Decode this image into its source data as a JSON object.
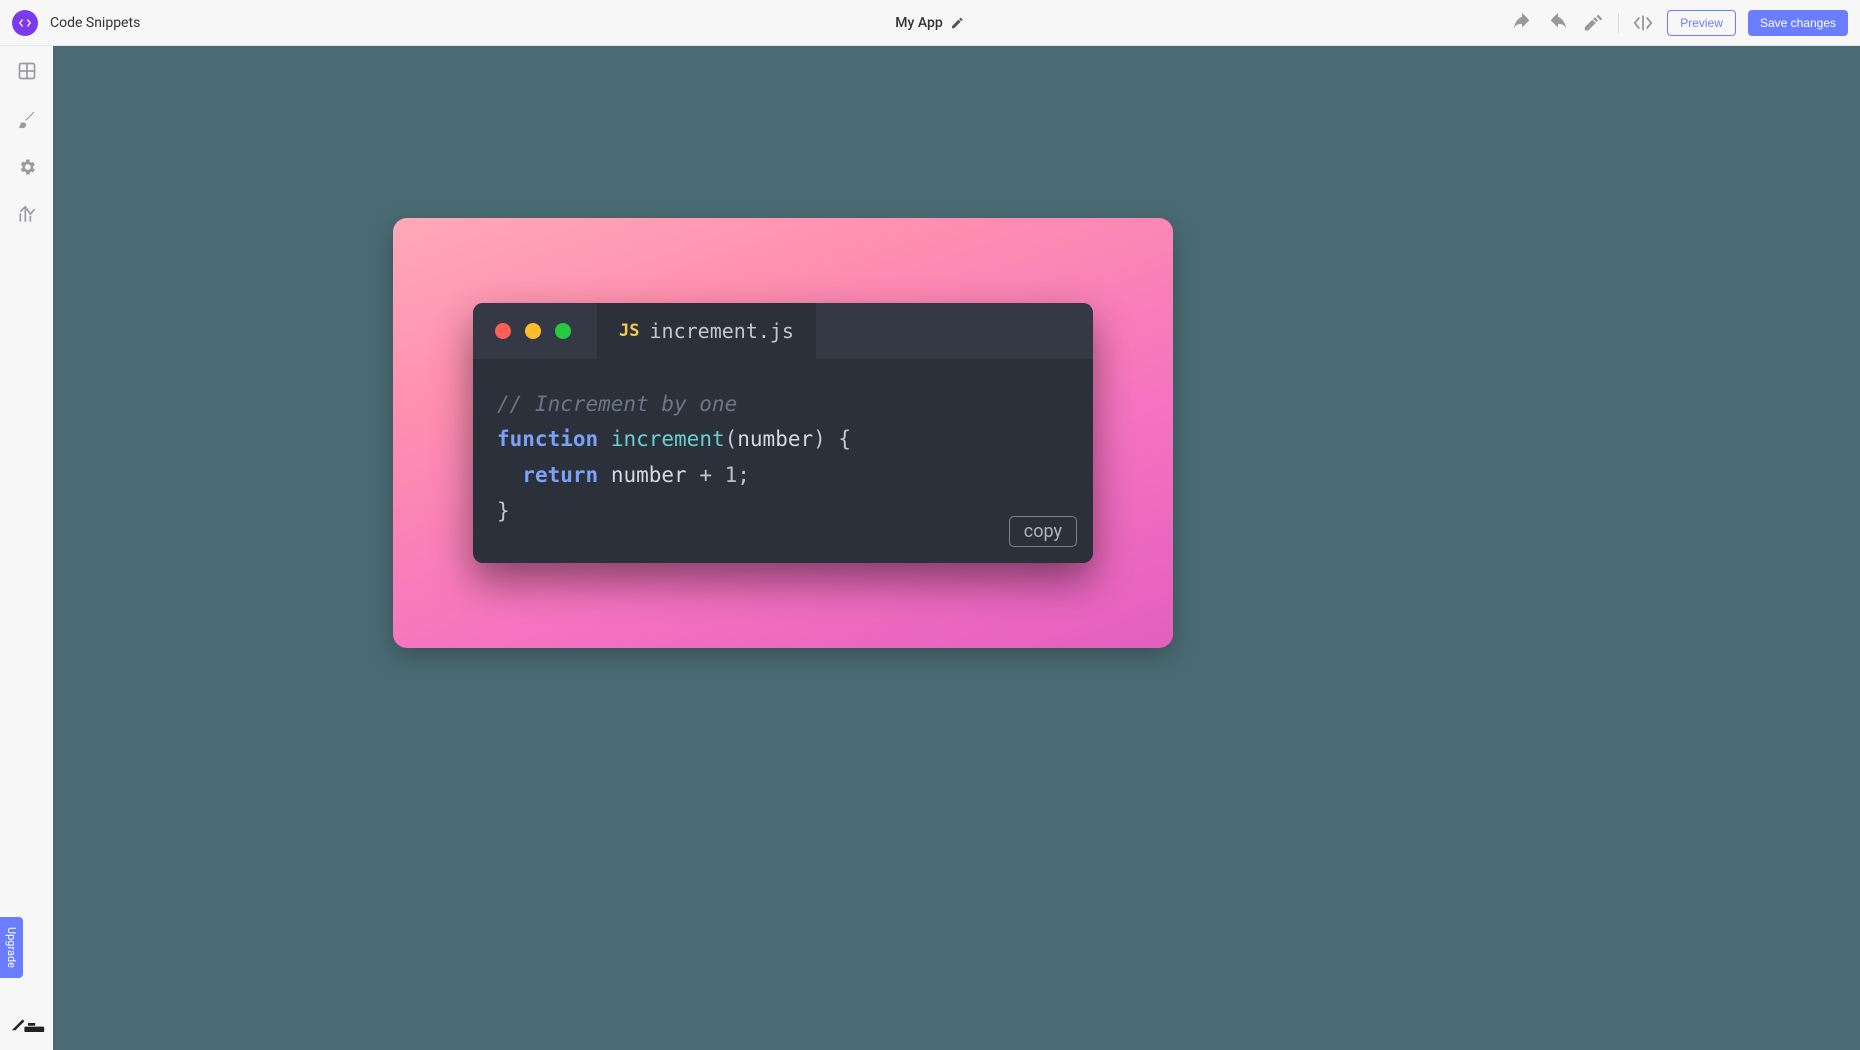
{
  "header": {
    "page_title": "Code Snippets",
    "app_name": "My App",
    "preview_label": "Preview",
    "save_label": "Save changes"
  },
  "sidebar": {
    "upgrade_label": "Upgrade"
  },
  "snippet": {
    "file_badge": "JS",
    "file_name": "increment.js",
    "copy_label": "copy",
    "code": {
      "comment": "// Increment by one",
      "kw_function": "function",
      "func_name": "increment",
      "param": "number",
      "kw_return": "return",
      "expr_ident": "number",
      "expr_op": " + ",
      "expr_num": "1",
      "open_paren": "(",
      "close_paren_brace": ") {",
      "semicolon": ";",
      "close_brace": "}"
    }
  }
}
